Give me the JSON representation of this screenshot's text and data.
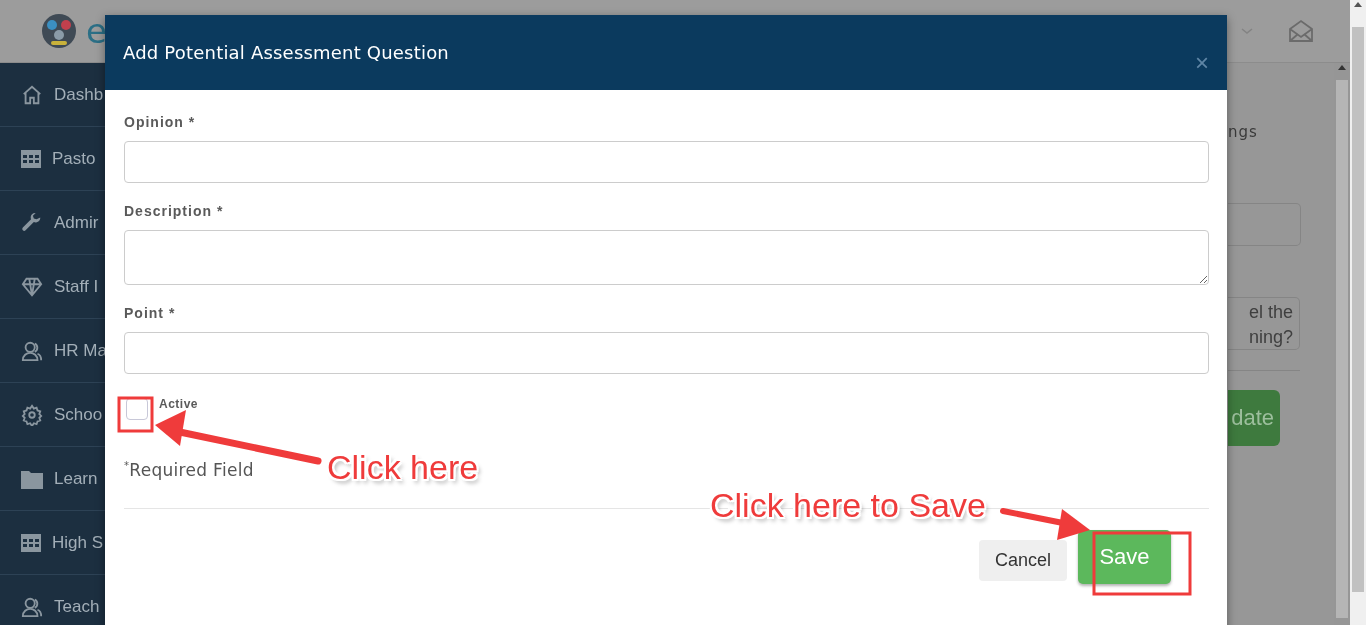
{
  "header": {
    "logo_text": "e"
  },
  "sidebar": {
    "items": [
      {
        "label": "Dashb"
      },
      {
        "label": "Pasto"
      },
      {
        "label": "Admir"
      },
      {
        "label": "Staff I"
      },
      {
        "label": "HR Ma"
      },
      {
        "label": "Schoo"
      },
      {
        "label": "Learn"
      },
      {
        "label": "High S"
      },
      {
        "label": "Teach"
      }
    ]
  },
  "background": {
    "section_text": "ngs",
    "textarea_lines": [
      "el the",
      "ning?"
    ],
    "button": "date"
  },
  "modal": {
    "title": "Add Potential Assessment Question",
    "close": "×",
    "fields": [
      {
        "label": "Opinion *",
        "kind": "input"
      },
      {
        "label": "Description *",
        "kind": "textarea"
      },
      {
        "label": "Point *",
        "kind": "input"
      }
    ],
    "checkbox": {
      "label": "Active",
      "checked": false
    },
    "note": "$^{*}$Required Field",
    "buttons": [
      {
        "label": "Cancel",
        "kind": "secondary"
      },
      {
        "label": "Save",
        "kind": "primary"
      }
    ]
  },
  "annotations": [
    {
      "text": "Click here"
    },
    {
      "text": "Click here to Save"
    }
  ]
}
